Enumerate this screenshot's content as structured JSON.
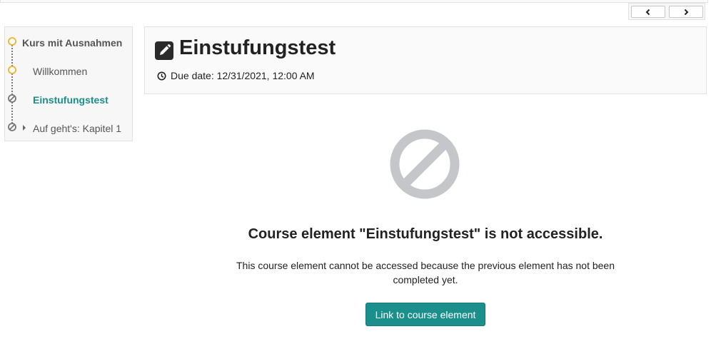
{
  "menu": {
    "root": {
      "label": "Kurs mit Ausnahmen",
      "status": "in-progress"
    },
    "items": [
      {
        "label": "Willkommen",
        "status": "in-progress"
      },
      {
        "label": "Einstufungstest",
        "status": "blocked",
        "active": true
      },
      {
        "label": "Auf geht's: Kapitel 1",
        "status": "blocked",
        "expandable": true
      }
    ]
  },
  "header": {
    "icon": "pencil-square-icon",
    "title": "Einstufungstest",
    "due_label": "Due date: 12/31/2021, 12:00 AM"
  },
  "message": {
    "icon": "blocked-icon",
    "title": "Course element \"Einstufungstest\" is not accessible.",
    "text": "This course element cannot be accessed because the previous element has not been completed yet.",
    "button_label": "Link to course element"
  },
  "colors": {
    "accent": "#1a8f8c",
    "in_progress": "#f0b429",
    "blocked_icon": "#c4c6c9"
  }
}
